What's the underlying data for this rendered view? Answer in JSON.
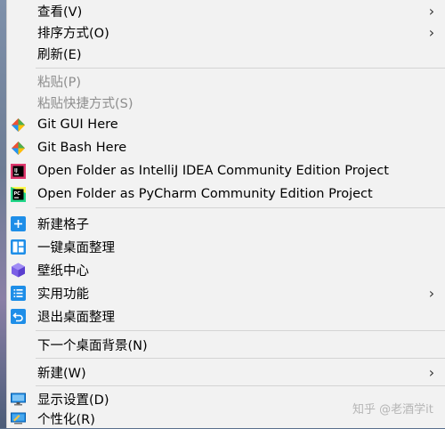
{
  "menu": {
    "view": "查看(V)",
    "sort": "排序方式(O)",
    "refresh": "刷新(E)",
    "paste": "粘贴(P)",
    "paste_shortcut": "粘贴快捷方式(S)",
    "git_gui": "Git GUI Here",
    "git_bash": "Git Bash Here",
    "open_intellij": "Open Folder as IntelliJ IDEA Community Edition Project",
    "open_pycharm": "Open Folder as PyCharm Community Edition Project",
    "new_grid": "新建格子",
    "one_click_organize": "一键桌面整理",
    "wallpaper_center": "壁纸中心",
    "utilities": "实用功能",
    "exit_organize": "退出桌面整理",
    "next_background": "下一个桌面背景(N)",
    "new": "新建(W)",
    "display_settings": "显示设置(D)",
    "personalize": "个性化(R)"
  },
  "watermark": "知乎 @老酒学it",
  "icons": {
    "git": "git-icon",
    "intellij": "intellij-icon",
    "pycharm": "pycharm-icon",
    "plus": "plus-icon",
    "grid": "grid-icon",
    "cube": "cube-icon",
    "list": "list-icon",
    "exit": "exit-icon",
    "monitor": "monitor-icon",
    "personalize": "personalize-icon"
  },
  "colors": {
    "menu_bg": "#f2f2f2",
    "disabled_text": "#8d8d8d",
    "separator": "#d4d4d4",
    "accent_blue": "#1e8ee8",
    "cube_purple": "#7b5fe6"
  }
}
